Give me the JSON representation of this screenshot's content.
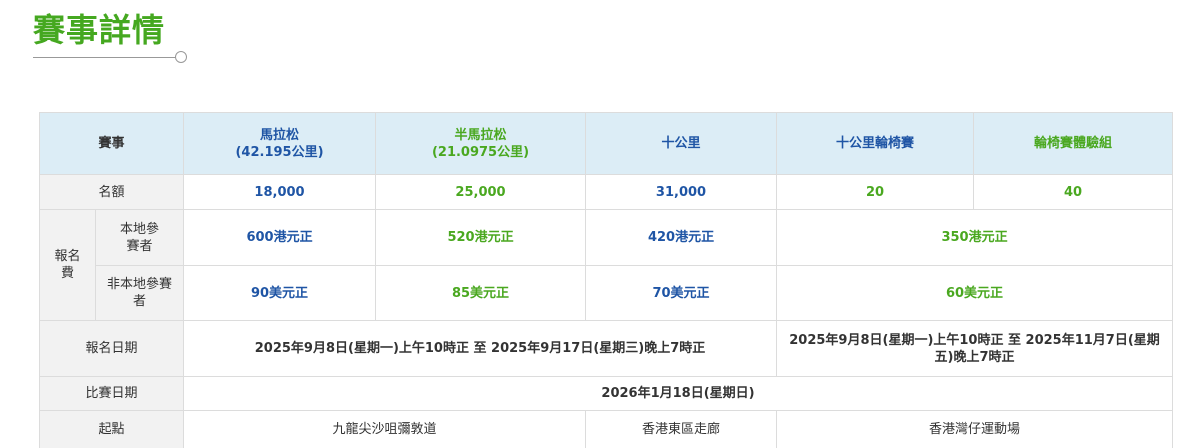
{
  "page": {
    "title": "賽事詳情"
  },
  "table": {
    "header": {
      "label": "賽事",
      "marathon": {
        "name": "馬拉松",
        "distance": "(42.195公里)"
      },
      "half": {
        "name": "半馬拉松",
        "distance": "(21.0975公里)"
      },
      "tenk": "十公里",
      "wheelchair": "十公里輪椅賽",
      "experience": "輪椅賽體驗組"
    },
    "quota": {
      "label": "名額",
      "marathon": "18,000",
      "half": "25,000",
      "tenk": "31,000",
      "wheelchair": "20",
      "experience": "40"
    },
    "fee": {
      "label": "報名費",
      "local": {
        "label": "本地參賽者",
        "marathon": "600港元正",
        "half": "520港元正",
        "tenk": "420港元正",
        "wheelchair_group": "350港元正"
      },
      "nonlocal": {
        "label": "非本地參賽者",
        "marathon": "90美元正",
        "half": "85美元正",
        "tenk": "70美元正",
        "wheelchair_group": "60美元正"
      }
    },
    "registration": {
      "label": "報名日期",
      "main": "2025年9月8日(星期一)上午10時正 至 2025年9月17日(星期三)晚上7時正",
      "wheelchair": "2025年9月8日(星期一)上午10時正 至 2025年11月7日(星期五)晚上7時正"
    },
    "race_date": {
      "label": "比賽日期",
      "value": "2026年1月18日(星期日)"
    },
    "start": {
      "label": "起點",
      "main": "九龍尖沙咀彌敦道",
      "tenk": "香港東區走廊",
      "wheelchair": "香港灣仔運動場"
    }
  }
}
